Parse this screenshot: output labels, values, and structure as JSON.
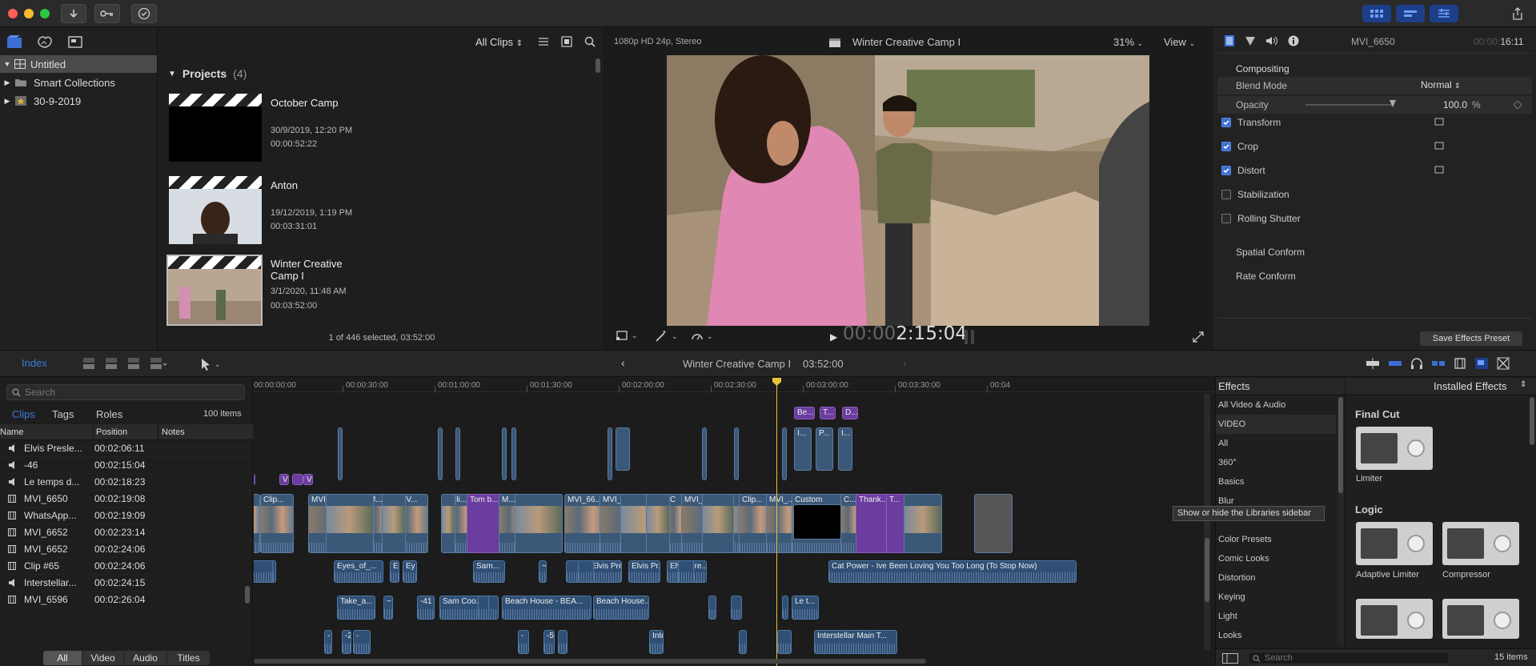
{
  "toolbar": {
    "icons": [
      "import-icon",
      "keywords-icon",
      "background-tasks-icon"
    ],
    "right_icons": [
      "libraries-layout-icon",
      "browser-layout-icon",
      "inspector-layout-icon",
      "share-icon"
    ]
  },
  "library": {
    "items": [
      {
        "label": "Untitled",
        "selected": true
      },
      {
        "label": "Smart Collections",
        "selected": false
      },
      {
        "label": "30-9-2019",
        "selected": false
      }
    ]
  },
  "browser": {
    "filter_label": "All Clips",
    "section_title": "Projects",
    "section_count": "(4)",
    "projects": [
      {
        "name": "October Camp",
        "date": "30/9/2019, 12:20 PM",
        "duration": "00:00:52:22"
      },
      {
        "name": "Anton",
        "date": "19/12/2019, 1:19 PM",
        "duration": "00:03:31:01"
      },
      {
        "name": "Winter Creative Camp I",
        "date": "3/1/2020, 11:48 AM",
        "duration": "00:03:52:00"
      }
    ],
    "status": "1 of 446 selected, 03:52:00"
  },
  "viewer": {
    "format": "1080p HD 24p, Stereo",
    "title": "Winter Creative Camp I",
    "zoom": "31%",
    "view_label": "View",
    "timecode_dim": "00:00",
    "timecode": "2:15:04"
  },
  "inspector": {
    "clip_name": "MVI_6650",
    "timecode_dim": "00:00:",
    "timecode": "16:11",
    "compositing": "Compositing",
    "blend_mode_label": "Blend Mode",
    "blend_mode_value": "Normal",
    "opacity_label": "Opacity",
    "opacity_value": "100.0",
    "opacity_unit": "%",
    "rows": [
      {
        "label": "Transform",
        "checked": true
      },
      {
        "label": "Crop",
        "checked": true
      },
      {
        "label": "Distort",
        "checked": true
      },
      {
        "label": "Stabilization",
        "checked": false
      },
      {
        "label": "Rolling Shutter",
        "checked": false
      }
    ],
    "spatial": "Spatial Conform",
    "rate": "Rate Conform",
    "save_preset": "Save Effects Preset"
  },
  "timeline_bar": {
    "index_label": "Index",
    "project": "Winter Creative Camp I",
    "duration": "03:52:00"
  },
  "index": {
    "search_placeholder": "Search",
    "tabs": [
      "Clips",
      "Tags",
      "Roles"
    ],
    "count": "100 items",
    "columns": [
      "Name",
      "Position",
      "Notes"
    ],
    "rows": [
      {
        "type": "audio",
        "name": "Elvis Presle...",
        "pos": "00:02:06:11"
      },
      {
        "type": "audio",
        "name": "-46",
        "pos": "00:02:15:04"
      },
      {
        "type": "audio",
        "name": "Le temps d...",
        "pos": "00:02:18:23"
      },
      {
        "type": "video",
        "name": "MVI_6650",
        "pos": "00:02:19:08"
      },
      {
        "type": "video",
        "name": "WhatsApp...",
        "pos": "00:02:19:09"
      },
      {
        "type": "video",
        "name": "MVI_6652",
        "pos": "00:02:23:14"
      },
      {
        "type": "video",
        "name": "MVI_6652",
        "pos": "00:02:24:06"
      },
      {
        "type": "video",
        "name": "Clip #65",
        "pos": "00:02:24:06"
      },
      {
        "type": "audio",
        "name": "Interstellar...",
        "pos": "00:02:24:15"
      },
      {
        "type": "video",
        "name": "MVI_6596",
        "pos": "00:02:26:04"
      }
    ],
    "filters": [
      "All",
      "Video",
      "Audio",
      "Titles"
    ]
  },
  "ruler": [
    "00:00:00:00",
    "00:00:30:00",
    "00:01:00:00",
    "00:01:30:00",
    "00:02:00:00",
    "00:02:30:00",
    "00:03:00:00",
    "00:03:30:00",
    "00:04"
  ],
  "timeline": {
    "video_labels": [
      "M",
      "M",
      "M",
      "Clip...",
      "MVI_6615",
      "M...",
      "MV...",
      "Cli...",
      "Tom b...",
      "M...",
      "MVI_66...",
      "MVI_6650",
      "C",
      "MVI_6598",
      "Clip...",
      "MVI_...",
      "Custom",
      "C...",
      "Thank...",
      "T..."
    ],
    "upper_labels": [
      "Be...",
      "T...",
      "D...",
      "I...",
      "P...",
      "I..."
    ],
    "title_small": [
      "V",
      "V"
    ],
    "audio1": [
      "Take_a_Br...",
      "Eyes_of_...",
      "E",
      "Ey",
      "Sam...",
      "~",
      "Elvis Presl...",
      "Elvis Pr...",
      "Elvis Pre...",
      "Cat Power - Ive Been Loving You Too Long (To Stop Now)"
    ],
    "audio2": [
      "Take_a...",
      "~",
      "-41",
      "Sam Coo...",
      "Beach House - BEA...",
      "Beach House...",
      "Le t..."
    ],
    "audio3": [
      "-",
      "-2",
      "-",
      "-",
      "-5",
      "Interstellar Main T..."
    ],
    "tooltip": "Show or hide the Libraries sidebar"
  },
  "effects": {
    "title": "Effects",
    "installed": "Installed Effects",
    "categories": [
      "All Video & Audio",
      "VIDEO",
      "All",
      "360°",
      "Basics",
      "Blur",
      "",
      "Color Presets",
      "Comic Looks",
      "Distortion",
      "Keying",
      "Light",
      "Looks"
    ],
    "group1": "Final Cut",
    "group2": "Logic",
    "items": [
      "Limiter",
      "Adaptive Limiter",
      "Compressor"
    ],
    "search_placeholder": "Search",
    "count": "15 items"
  },
  "colors": {
    "accent": "#3b6fd6",
    "playhead": "#e8c23a",
    "purple": "#6a3d9e",
    "clipblue": "#3b5878"
  }
}
